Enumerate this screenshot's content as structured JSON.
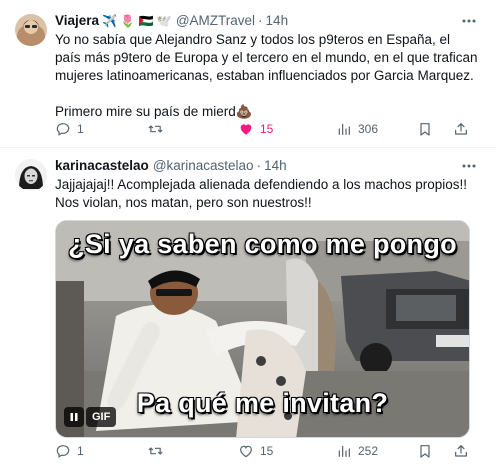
{
  "tweets": [
    {
      "name": "Viajera",
      "name_emojis": "✈️ 🌷 🇵🇸 🕊️",
      "handle": "@AMZTravel",
      "separator": "·",
      "time": "14h",
      "paragraphs": [
        "Yo no sabía que Alejandro Sanz y todos los p9teros en España, el país más p9tero de Europa y el tercero en el mundo, en el que trafican mujeres latinoamericanas, estaban influenciados por Garcia Marquez.",
        "Primero mire su país de mierd💩"
      ],
      "replies": "1",
      "retweets": "",
      "likes": "15",
      "liked": true,
      "views": "306"
    },
    {
      "name": "karinacastelao",
      "handle": "@karinacastelao",
      "separator": "·",
      "time": "14h",
      "paragraphs": [
        "Jajjajajaj!! Acomplejada alienada defendiendo a los machos propios!! Nos violan, nos matan, pero son nuestros!!"
      ],
      "media": {
        "type": "GIF",
        "caption_top": "¿Si ya saben como me pongo",
        "caption_bottom": "Pa qué me invitan?",
        "gif_label": "GIF"
      },
      "replies": "1",
      "retweets": "",
      "likes": "15",
      "liked": false,
      "views": "252"
    }
  ],
  "icons": {
    "more": "more-horizontal-icon",
    "reply": "reply-icon",
    "retweet": "retweet-icon",
    "like": "heart-icon",
    "views": "views-icon",
    "bookmark": "bookmark-icon",
    "share": "share-icon"
  },
  "colors": {
    "text": "#0f1419",
    "secondary": "#536471",
    "like_active": "#f91880",
    "divider": "#eff3f4"
  }
}
